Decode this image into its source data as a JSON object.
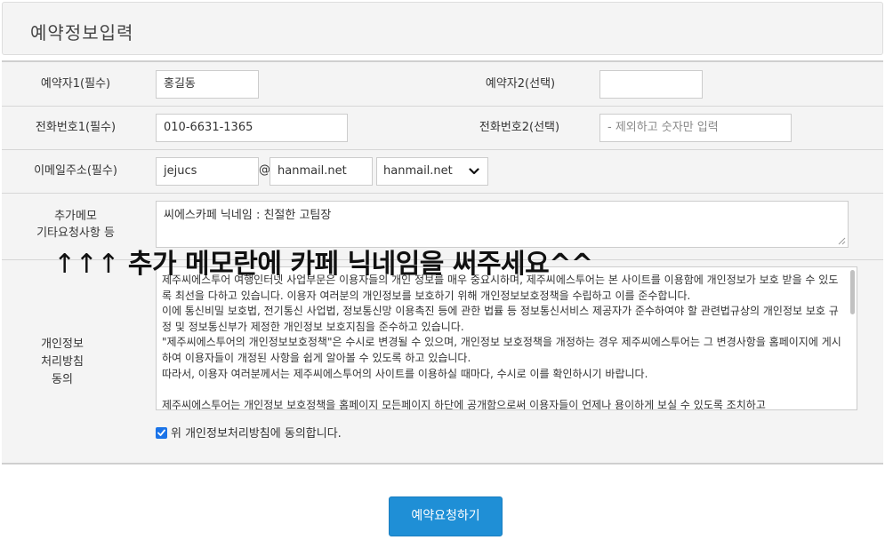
{
  "header": {
    "title": "예약정보입력"
  },
  "form": {
    "booker1_label": "예약자1(필수)",
    "booker1_value": "홍길동",
    "booker2_label": "예약자2(선택)",
    "booker2_value": "",
    "phone1_label": "전화번호1(필수)",
    "phone1_value": "010-6631-1365",
    "phone2_label": "전화번호2(선택)",
    "phone2_placeholder": "- 제외하고 숫자만 입력",
    "email_label": "이메일주소(필수)",
    "email_id": "jejucs",
    "email_at": "@",
    "email_domain": "hanmail.net",
    "email_domain_select": "hanmail.net",
    "memo_label_line1": "추가메모",
    "memo_label_line2": "기타요청사항 등",
    "memo_value": "씨에스카페 닉네임 : 친절한 고팀장",
    "privacy_label_line1": "개인정보",
    "privacy_label_line2": "처리방침",
    "privacy_label_line3": "동의",
    "privacy_paragraphs": [
      "제주씨에스투어 여행인터넷 사업부문은 이용자들의 개인 정보를 매우 중요시하며, 제주씨에스투어는 본 사이트를 이용함에 개인정보가 보호 받을 수 있도록 최선을 다하고 있습니다. 이용자 여러분의 개인정보를 보호하기 위해 개인정보보호정책을 수립하고 이를 준수합니다.",
      "이에 통신비밀 보호법, 전기통신 사업법, 정보통신망 이용촉진 등에 관한 법률 등 정보통신서비스 제공자가 준수하여야 할 관련법규상의 개인정보 보호 규정 및 정보통신부가 제정한 개인정보 보호지침을 준수하고 있습니다.",
      "\"제주씨에스투어의 개인정보보호정책\"은 수시로 변경될 수 있으며, 개인정보 보호정책을 개정하는 경우 제주씨에스투어는 그 변경사항을 홈페이지에 게시하여 이용자들이 개정된 사항을 쉽게 알아볼 수 있도록 하고 있습니다.",
      "따라서, 이용자 여러분께서는 제주씨에스투어의 사이트를 이용하실 때마다, 수시로 이를 확인하시기 바랍니다.",
      "",
      "제주씨에스투어는 개인정보 보호정책을 홈페이지 모든페이지 하단에 공개함으로써 이용자들이 언제나 용이하게 보실 수 있도록 조치하고"
    ],
    "agree_label": "위 개인정보처리방침에 동의합니다.",
    "agree_checked": true
  },
  "overlay": {
    "arrows": "↑↑↑",
    "text": "추가 메모란에 카페 닉네임을 써주세요^^"
  },
  "submit_label": "예약요청하기",
  "colors": {
    "button": "#1f8fd6",
    "panel_bg": "#f4f4f4",
    "checkbox": "#1a73e8"
  }
}
